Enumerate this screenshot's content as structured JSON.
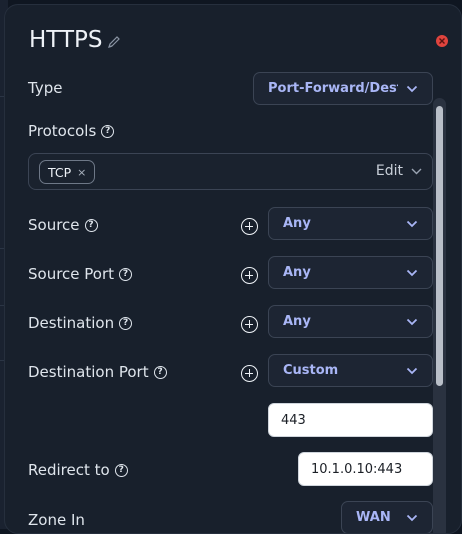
{
  "dialog": {
    "title": "HTTPS"
  },
  "fields": {
    "type": {
      "label": "Type",
      "value": "Port-Forward/Dest"
    },
    "protocols": {
      "label": "Protocols",
      "chip": "TCP",
      "chip_remove": "×",
      "edit_label": "Edit"
    },
    "source": {
      "label": "Source",
      "value": "Any"
    },
    "source_port": {
      "label": "Source Port",
      "value": "Any"
    },
    "destination": {
      "label": "Destination",
      "value": "Any"
    },
    "destination_port": {
      "label": "Destination Port",
      "value": "Custom",
      "custom_value": "443"
    },
    "redirect_to": {
      "label": "Redirect to",
      "value": "10.1.0.10:443"
    },
    "zone_in": {
      "label": "Zone In",
      "value": "WAN"
    }
  },
  "help_glyph": "?",
  "colors": {
    "panel_bg": "#18202c",
    "accent_text": "#a9b6f6",
    "close_red": "#e0443e"
  }
}
